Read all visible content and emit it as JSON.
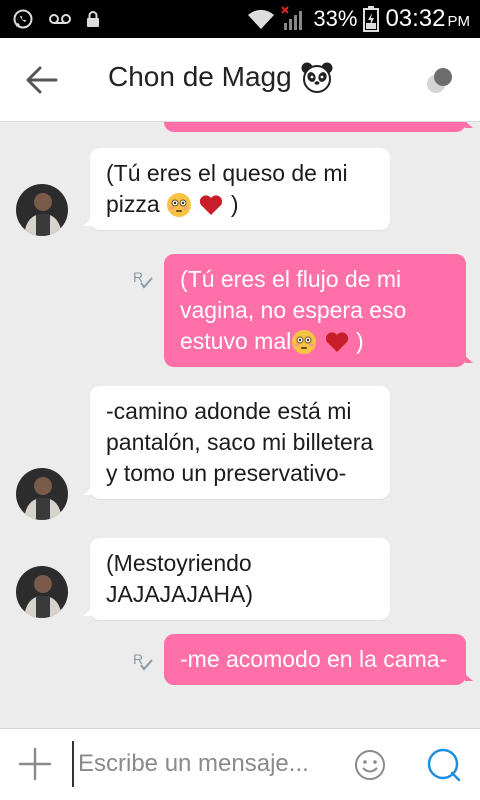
{
  "status_bar": {
    "battery_percent": "33%",
    "time": "03:32",
    "ampm": "PM"
  },
  "header": {
    "title": "Chon de Magg"
  },
  "messages": [
    {
      "from": "them",
      "text": "(Tú eres el queso de mi pizza",
      "suffix": ")"
    },
    {
      "from": "me",
      "text": "(Tú eres el flujo de mi vagina, no espera eso estuvo mal",
      "suffix": ")"
    },
    {
      "from": "them",
      "text": "-camino adonde está mi pantalón, saco mi billetera y tomo un preservativo-"
    },
    {
      "from": "them",
      "text": "(Mestoyriendo JAJAJAJAHA)"
    },
    {
      "from": "me",
      "text": "-me acomodo en la cama-"
    }
  ],
  "input": {
    "placeholder": "Escribe un mensaje..."
  },
  "colors": {
    "outgoing_bubble": "#ff6fa8",
    "incoming_bubble": "#ffffff",
    "send_accent": "#1e8fe0"
  }
}
